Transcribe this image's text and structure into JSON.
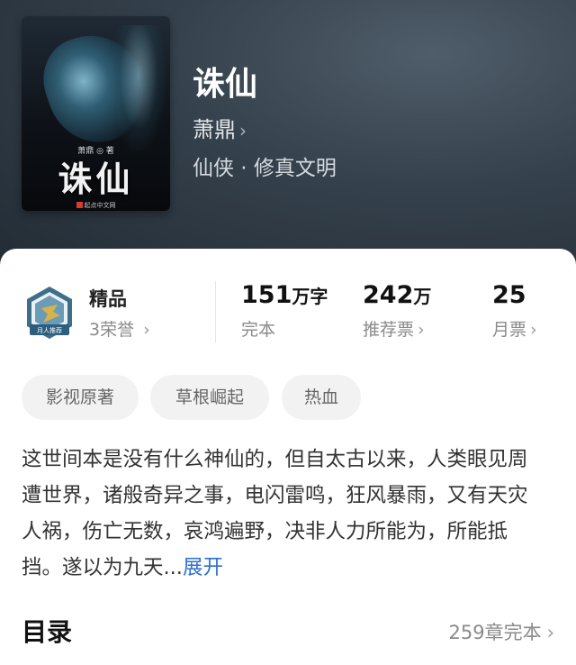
{
  "book": {
    "title": "诛仙",
    "author": "萧鼎",
    "genre": "仙侠 · 修真文明",
    "cover": {
      "title_text": "诛仙",
      "author_text": "萧鼎 ◎ 著",
      "publisher_text": "起点中文网"
    }
  },
  "honor": {
    "title": "精品",
    "subtitle": "3荣誉",
    "badge_text": "月人推荐"
  },
  "stats": [
    {
      "value": "151",
      "unit": "万字",
      "label": "完本",
      "has_chevron": false
    },
    {
      "value": "242",
      "unit": "万",
      "label": "推荐票",
      "has_chevron": true
    },
    {
      "value": "25",
      "unit": "",
      "label": "月票",
      "has_chevron": true
    }
  ],
  "tags": [
    "影视原著",
    "草根崛起",
    "热血"
  ],
  "description": {
    "text": "这世间本是没有什么神仙的，但自太古以来，人类眼见周遭世界，诸般奇异之事，电闪雷鸣，狂风暴雨，又有天灾人祸，伤亡无数，哀鸿遍野，决非人力所能为，所能抵挡。遂以为九天...",
    "expand_label": "展开"
  },
  "toc": {
    "title": "目录",
    "summary": "259章完本"
  },
  "icons": {
    "chevron": "chevron-right-icon"
  },
  "colors": {
    "link": "#2d6fd0",
    "hero_bg": "#2e3944",
    "tag_bg": "#f2f2f2"
  }
}
